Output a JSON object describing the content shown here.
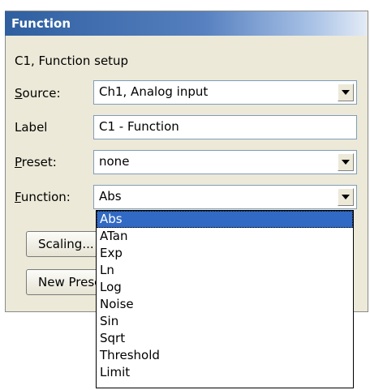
{
  "window": {
    "title": "Function"
  },
  "section": {
    "heading": "C1, Function setup"
  },
  "source": {
    "label": "Source:",
    "value": "Ch1, Analog input"
  },
  "label_field": {
    "label": "Label",
    "value": "C1 - Function"
  },
  "preset": {
    "label": "Preset:",
    "value": "none"
  },
  "function": {
    "label": "Function:",
    "value": "Abs",
    "options": [
      "Abs",
      "ATan",
      "Exp",
      "Ln",
      "Log",
      "Noise",
      "Sin",
      "Sqrt",
      "Threshold",
      "Limit"
    ],
    "selected_index": 0
  },
  "buttons": {
    "scaling": "Scaling...",
    "new_preset": "New Preset..."
  }
}
